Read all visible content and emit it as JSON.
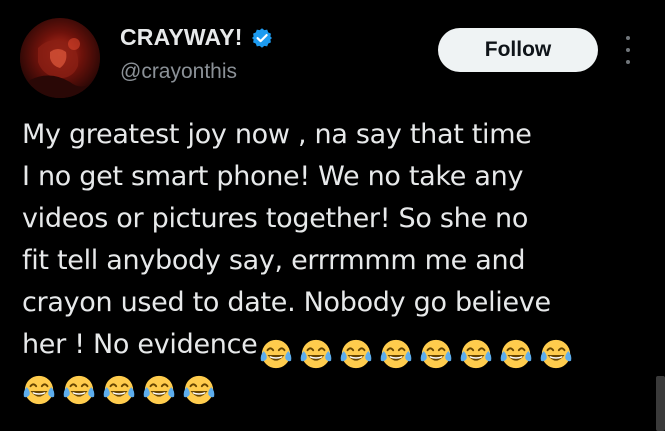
{
  "author": {
    "display_name": "CRAYWAY!",
    "handle": "@crayonthis",
    "verified": true,
    "avatar": "avatar-photo"
  },
  "actions": {
    "follow_label": "Follow",
    "more_icon": "more-vertical-icon"
  },
  "tweet": {
    "text": "My greatest joy now , na say that time\nI no get smart phone! We no take any\nvideos or pictures together! So she no\nfit tell anybody say, errrmmm me and\ncrayon used to date. Nobody go believe\nher ! No evidence",
    "emoji": "😂",
    "emoji_count_inline": 8,
    "emoji_count_next_line": 5
  },
  "colors": {
    "background": "#000000",
    "text": "#e7e9ea",
    "secondary_text": "#8b9197",
    "verified_blue": "#1d9bf0",
    "follow_bg": "#eff3f4"
  }
}
